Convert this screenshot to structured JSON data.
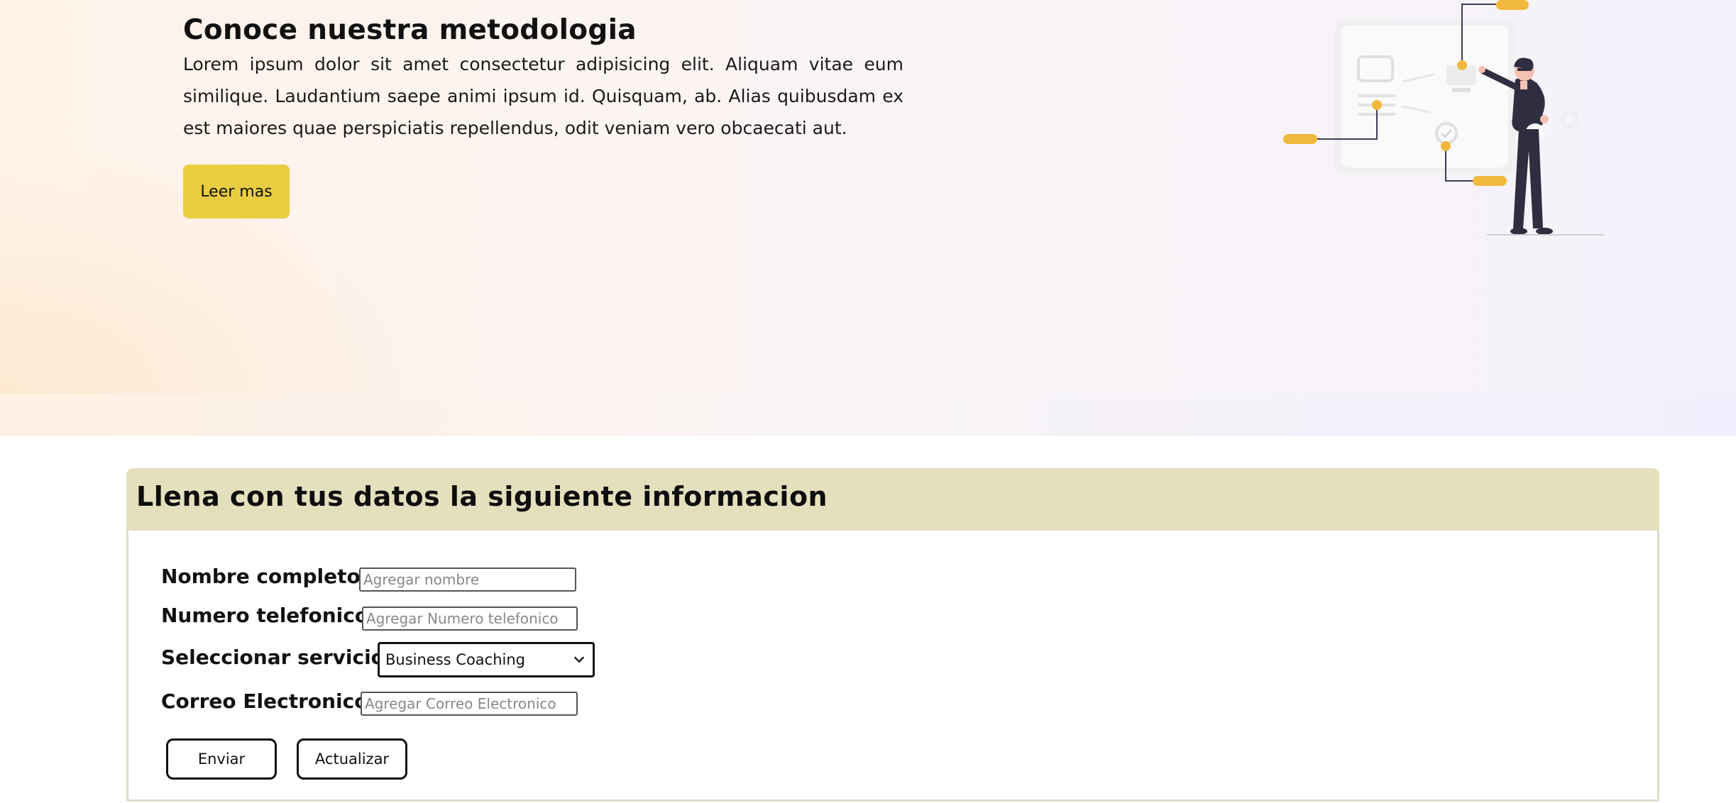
{
  "hero": {
    "title": "Conoce nuestra metodologia",
    "paragraph": "Lorem ipsum dolor sit amet consectetur adipisicing elit. Aliquam vitae eum similique. Laudantium saepe animi ipsum id. Quisquam, ab. Alias quibusdam ex est maiores quae perspiciatis repellendus, odit veniam vero obcaecati aut.",
    "button_label": "Leer mas"
  },
  "form": {
    "title": "Llena con tus datos la siguiente informacion",
    "fields": {
      "name": {
        "label": "Nombre completo",
        "placeholder": "Agregar nombre",
        "value": ""
      },
      "phone": {
        "label": "Numero telefonico",
        "placeholder": "Agregar Numero telefonico",
        "value": ""
      },
      "service": {
        "label": "Seleccionar servicio",
        "selected": "Business Coaching"
      },
      "email": {
        "label": "Correo Electronico",
        "placeholder": "Agregar Correo Electronico",
        "value": ""
      }
    },
    "buttons": {
      "submit": "Enviar",
      "reset": "Actualizar"
    }
  },
  "colors": {
    "accent": "#e8cd41",
    "form_header": "#e4e0be",
    "illustration_accent": "#f0b93e",
    "figure_dark": "#2f2e41"
  },
  "icons": [
    "presentation-illustration",
    "chevron-down-icon"
  ]
}
